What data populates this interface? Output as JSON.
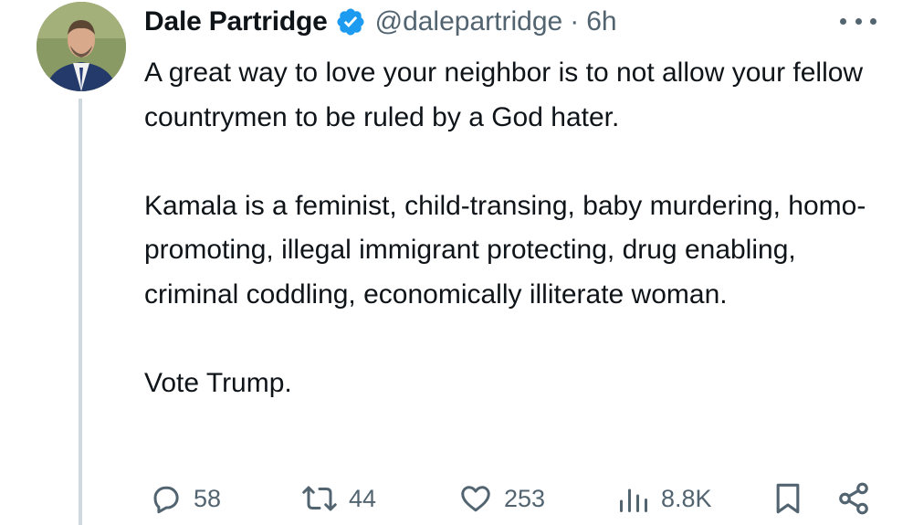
{
  "author": {
    "name": "Dale Partridge",
    "handle": "@dalepartridge",
    "separator": "·",
    "time": "6h"
  },
  "tweet": {
    "paragraphs": [
      "A great way to love your neighbor is to not allow your fellow countrymen to be ruled by a God hater.",
      "Kamala is a feminist, child-transing, baby murdering, homo-promoting, illegal immigrant protecting, drug enabling, criminal coddling, economically illiterate woman.",
      "Vote Trump."
    ]
  },
  "actions": {
    "replies": "58",
    "reposts": "44",
    "likes": "253",
    "views": "8.8K"
  },
  "icons": [
    "reply-icon",
    "repost-icon",
    "like-icon",
    "views-icon",
    "bookmark-icon",
    "share-icon",
    "verified-badge-icon",
    "more-icon"
  ],
  "colors": {
    "verified": "#1d9bf0",
    "muted": "#536471",
    "text": "#0f1419",
    "thread_line": "#cfd9de"
  }
}
